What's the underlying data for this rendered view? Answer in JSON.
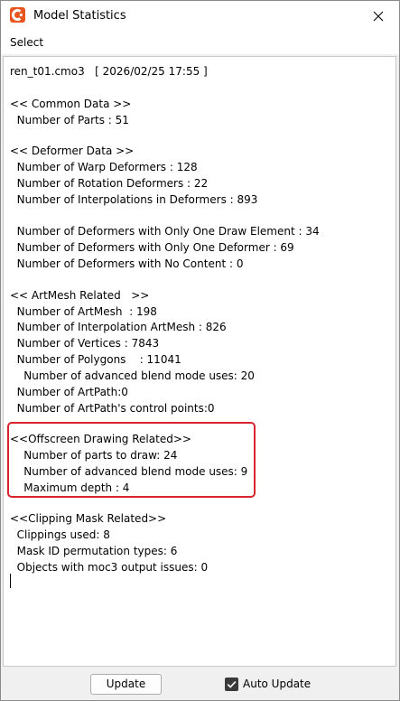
{
  "window": {
    "title": "Model Statistics",
    "menu": {
      "select_label": "Select"
    }
  },
  "report": {
    "file_line": "ren_t01.cmo3   [ 2026/02/25 17:55 ]",
    "lines": [
      "<< Common Data >>",
      "  Number of Parts : 51",
      "<< Deformer Data >>",
      "  Number of Warp Deformers : 128",
      "  Number of Rotation Deformers : 22",
      "  Number of Interpolations in Deformers : 893",
      "  Number of Deformers with Only One Draw Element : 34",
      "  Number of Deformers with Only One Deformer : 69",
      "  Number of Deformers with No Content : 0",
      "<< ArtMesh Related   >>",
      "  Number of ArtMesh  : 198",
      "  Number of Interpolation ArtMesh : 826",
      "  Number of Vertices : 7843",
      "  Number of Polygons    : 11041",
      "    Number of advanced blend mode uses: 20",
      "  Number of ArtPath:0",
      "  Number of ArtPath's control points:0",
      "<<Offscreen Drawing Related>>",
      "    Number of parts to draw: 24",
      "    Number of advanced blend mode uses: 9",
      "    Maximum depth : 4",
      "<<Clipping Mask Related>>",
      "  Clippings used: 8",
      "  Mask ID permutation types: 6",
      "  Objects with moc3 output issues: 0"
    ]
  },
  "footer": {
    "update_label": "Update",
    "auto_update_label": "Auto Update",
    "auto_update_checked": true
  },
  "colors": {
    "highlight_border": "#d9232d",
    "app_icon": "#e8551f"
  },
  "icons": {
    "app": "app-logo-icon",
    "close": "close-icon",
    "checkbox": "checkmark-icon"
  }
}
